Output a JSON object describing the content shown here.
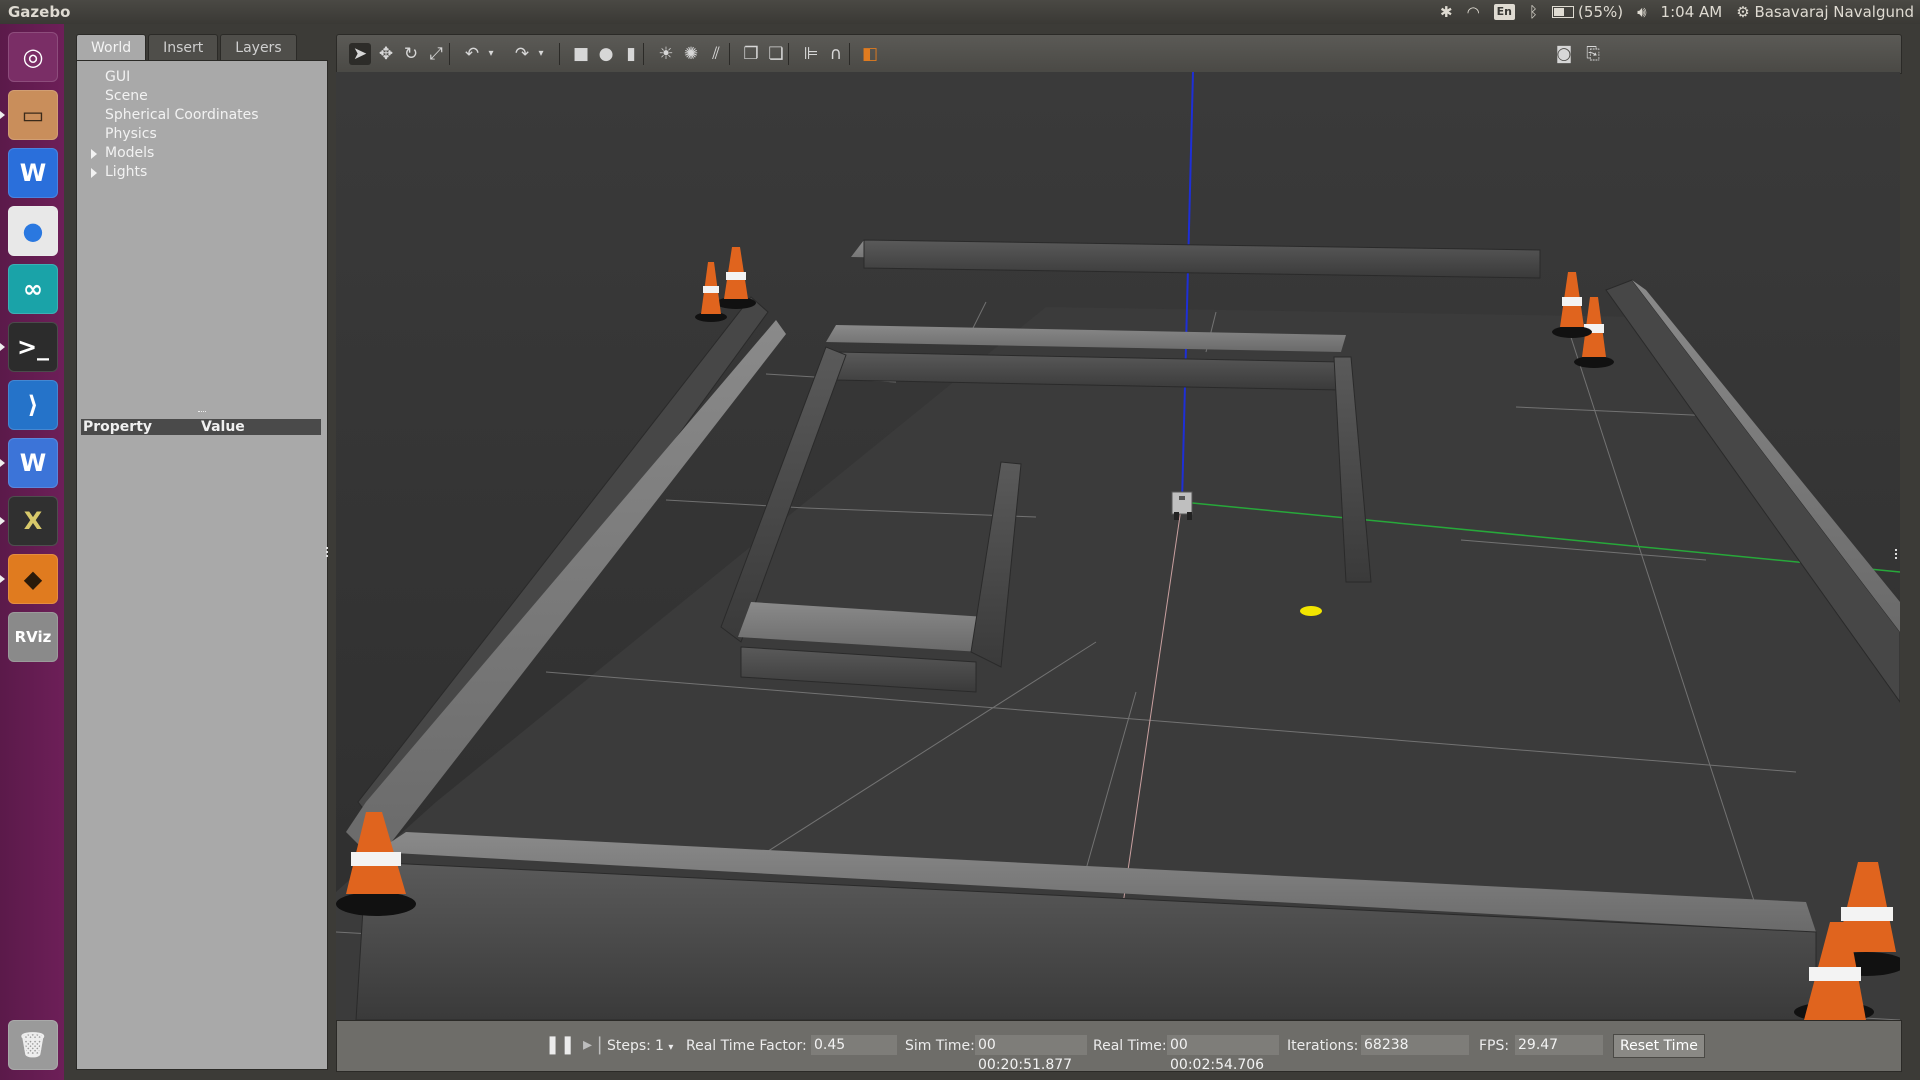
{
  "app_title": "Gazebo",
  "tray": {
    "keyboard": "En",
    "battery": "(55%)",
    "battery_level": 0.55,
    "time": "1:04 AM",
    "user": "Basavaraj Navalgund"
  },
  "launcher": [
    {
      "name": "ubuntu-dash-icon",
      "glyph": "◎",
      "bg": "#7a2e66",
      "fg": "#ffffff"
    },
    {
      "name": "files-icon",
      "glyph": "▭",
      "bg": "#c98e5b",
      "fg": "#3a2a1a"
    },
    {
      "name": "wps-writer-icon",
      "glyph": "W",
      "bg": "#2a6fdb",
      "fg": "#ffffff"
    },
    {
      "name": "chrome-icon",
      "glyph": "●",
      "bg": "#e8e8e8",
      "fg": "#2a78e0"
    },
    {
      "name": "arduino-icon",
      "glyph": "∞",
      "bg": "#1aa3a8",
      "fg": "#ffffff"
    },
    {
      "name": "terminal-icon",
      "glyph": ">_",
      "bg": "#2c2c2c",
      "fg": "#ffffff"
    },
    {
      "name": "vscode-icon",
      "glyph": "⟩",
      "bg": "#2573c9",
      "fg": "#ffffff"
    },
    {
      "name": "wps-icon",
      "glyph": "W",
      "bg": "#3c74d8",
      "fg": "#ffffff"
    },
    {
      "name": "xterm-icon",
      "glyph": "X",
      "bg": "#303030",
      "fg": "#d8c96a"
    },
    {
      "name": "gazebo-icon",
      "glyph": "◆",
      "bg": "#e07b1f",
      "fg": "#2a1a0a"
    },
    {
      "name": "rviz-icon",
      "glyph": "RViz",
      "bg": "#8a8a8a",
      "fg": "#ffffff"
    }
  ],
  "trash_icon": "trash-icon",
  "tabs": [
    "World",
    "Insert",
    "Layers"
  ],
  "tree": [
    {
      "label": "GUI",
      "expandable": false
    },
    {
      "label": "Scene",
      "expandable": false
    },
    {
      "label": "Spherical Coordinates",
      "expandable": false
    },
    {
      "label": "Physics",
      "expandable": false
    },
    {
      "label": "Models",
      "expandable": true
    },
    {
      "label": "Lights",
      "expandable": true
    }
  ],
  "properties": {
    "col_property": "Property",
    "col_value": "Value"
  },
  "toolbar_icons": [
    "select-arrow-icon",
    "translate-icon",
    "rotate-icon",
    "scale-icon",
    "undo-icon",
    "undo-dropdown-icon",
    "redo-icon",
    "redo-dropdown-icon",
    "box-icon",
    "sphere-icon",
    "cylinder-icon",
    "point-light-icon",
    "spot-light-icon",
    "directional-light-icon",
    "copy-icon",
    "paste-icon",
    "align-icon",
    "snap-icon",
    "view-angle-icon",
    "screenshot-icon",
    "log-icon"
  ],
  "status": {
    "steps_label": "Steps:",
    "steps_value": "1",
    "rtf_label": "Real Time Factor:",
    "rtf_value": "0.45",
    "sim_label": "Sim Time:",
    "sim_value": "00 00:20:51.877",
    "real_label": "Real Time:",
    "real_value": "00 00:02:54.706",
    "iter_label": "Iterations:",
    "iter_value": "68238",
    "fps_label": "FPS:",
    "fps_value": "29.47",
    "reset_label": "Reset Time"
  },
  "colors": {
    "launcher": "#6d1f58",
    "panel": "#a9a9a9",
    "viewport": "#333333",
    "cone_orange": "#e0641e",
    "target_marker": "#f2e500"
  }
}
